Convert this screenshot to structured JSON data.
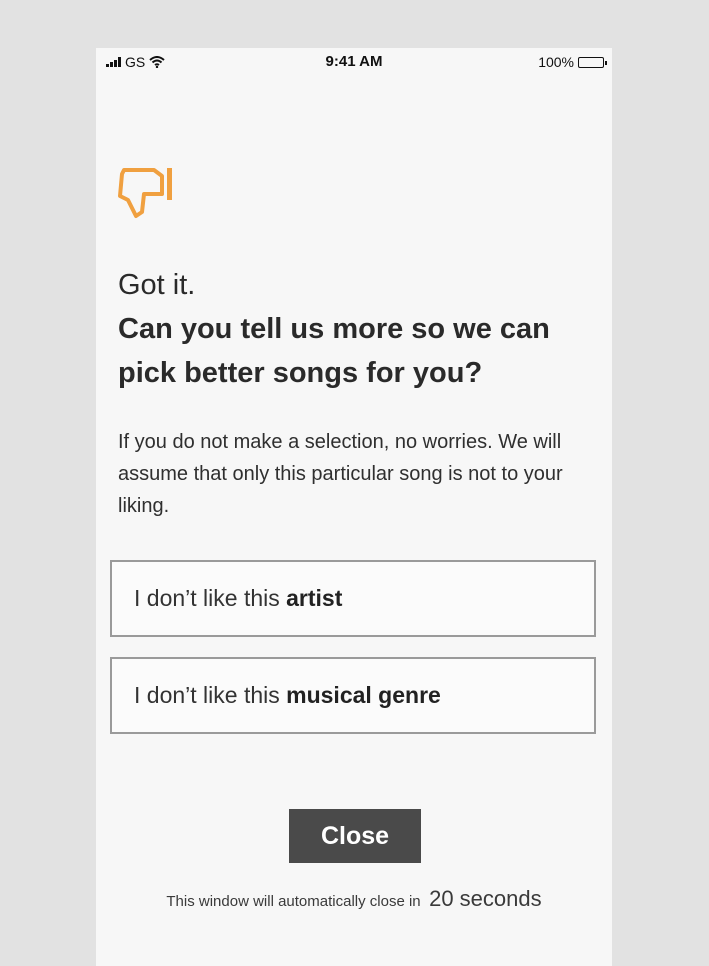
{
  "status_bar": {
    "carrier": "GS",
    "time": "9:41 AM",
    "battery": "100%"
  },
  "icons": {
    "dislike": "thumbs-down-icon",
    "signal": "signal-bars-icon",
    "wifi": "wifi-icon",
    "battery": "battery-icon"
  },
  "colors": {
    "accent": "#f0a040",
    "button_bg": "#4a4a4a",
    "page_bg": "#f7f7f7",
    "outer_bg": "#e2e2e2"
  },
  "headline": {
    "line1": "Got it.",
    "line2": "Can you tell us more so we can pick better songs for you?"
  },
  "description": "If you do not make a selection, no worries. We will assume that only this particular song is not to your liking.",
  "options": [
    {
      "prefix": "I don’t like this",
      "emphasis": "artist"
    },
    {
      "prefix": "I don’t like this",
      "emphasis": "musical genre"
    }
  ],
  "close_label": "Close",
  "countdown": {
    "text": "This window will automatically close in",
    "value": "20 seconds"
  }
}
